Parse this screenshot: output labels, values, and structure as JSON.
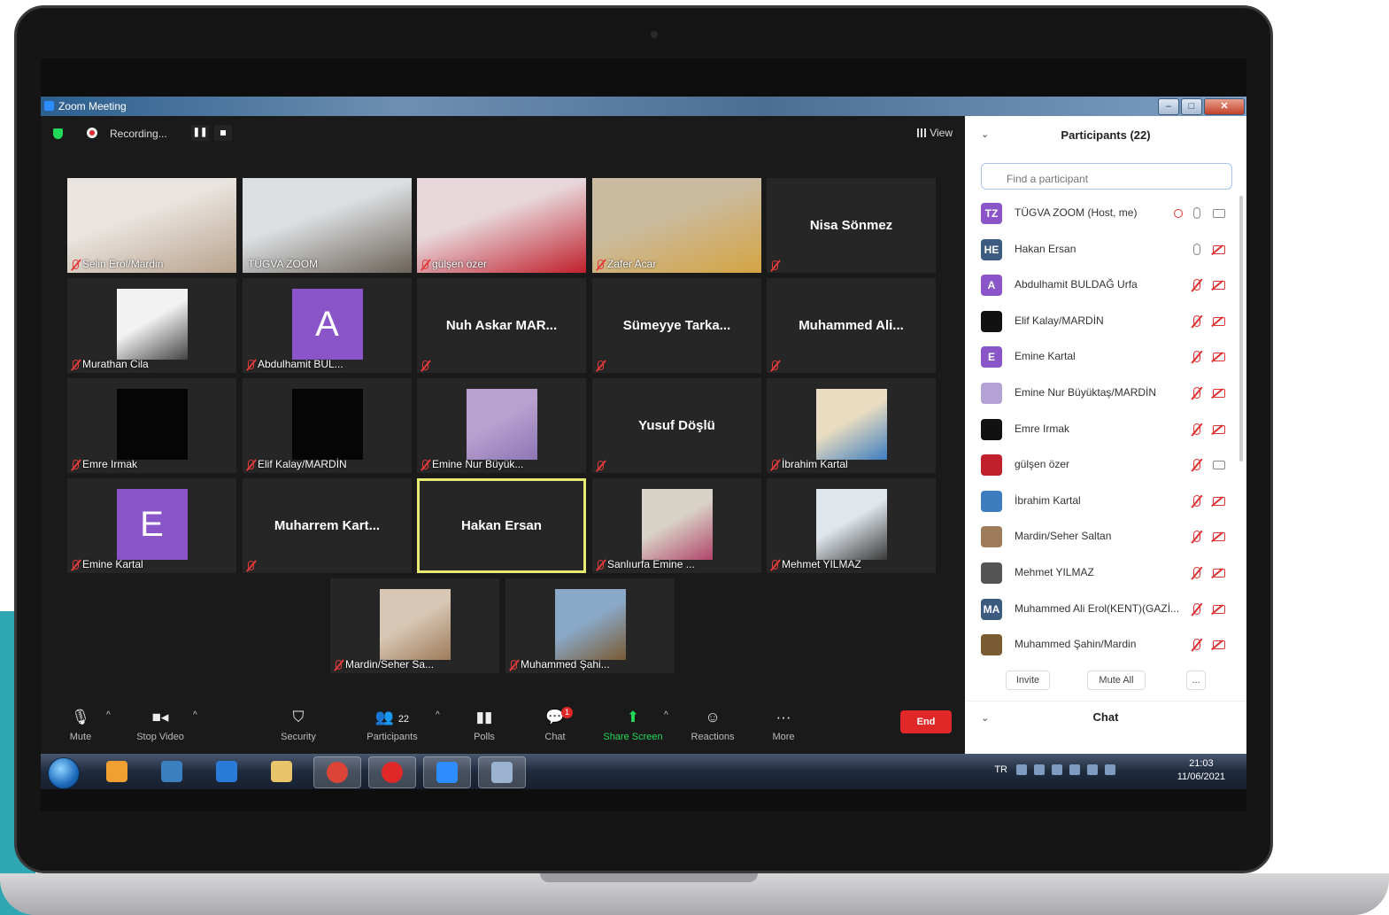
{
  "window": {
    "title": "Zoom Meeting"
  },
  "topbar": {
    "recording_label": "Recording...",
    "pause": "❚❚",
    "view_label": "View"
  },
  "tiles": [
    {
      "name": "Selin Erol/Mardin",
      "video": true,
      "muted": true,
      "colors": [
        "#e9e4df",
        "#b9a38d"
      ]
    },
    {
      "name": "TÜGVA ZOOM",
      "video": true,
      "muted": false,
      "colors": [
        "#dcdfe2",
        "#6b6258"
      ]
    },
    {
      "name": "gülşen özer",
      "video": true,
      "muted": true,
      "colors": [
        "#e7d6da",
        "#c0202c"
      ]
    },
    {
      "name": "Zafer Acar",
      "video": true,
      "muted": true,
      "colors": [
        "#cabba0",
        "#d5a442"
      ]
    },
    {
      "name": "",
      "big": "Nisa Sönmez",
      "muted": true
    },
    {
      "name": "Murathan Cila",
      "thumb": "photo",
      "muted": true,
      "colors": [
        "#f2f2f2",
        "#444444"
      ]
    },
    {
      "name": "Abdulhamit BUL...",
      "thumb": "letter",
      "letter": "A",
      "avatar_color": "#8a55c9",
      "muted": true
    },
    {
      "name": "",
      "big": "Nuh Askar MAR...",
      "muted": true
    },
    {
      "name": "",
      "big": "Sümeyye Tarka...",
      "muted": true
    },
    {
      "name": "",
      "big": "Muhammed Ali...",
      "muted": true
    },
    {
      "name": "Emre Irmak",
      "thumb": "black",
      "muted": true
    },
    {
      "name": "Elif Kalay/MARDİN",
      "thumb": "black",
      "muted": true
    },
    {
      "name": "Emine Nur Büyük...",
      "thumb": "photo",
      "muted": true,
      "colors": [
        "#b8a0cf",
        "#8d76b5"
      ]
    },
    {
      "name": "",
      "big": "Yusuf Döşlü",
      "muted": true
    },
    {
      "name": "İbrahim Kartal",
      "thumb": "photo",
      "muted": true,
      "colors": [
        "#e9dcc0",
        "#3d7dbf"
      ]
    },
    {
      "name": "Emine Kartal",
      "thumb": "letter",
      "letter": "E",
      "avatar_color": "#8a55c9",
      "muted": true
    },
    {
      "name": "",
      "big": "Muharrem Kart...",
      "muted": true
    },
    {
      "name": "",
      "big": "Hakan Ersan",
      "muted": false,
      "active": true
    },
    {
      "name": "Sanlıurfa Emine ...",
      "thumb": "photo",
      "muted": true,
      "colors": [
        "#d9d2c7",
        "#b0456a"
      ]
    },
    {
      "name": "Mehmet YILMAZ",
      "thumb": "photo",
      "muted": true,
      "colors": [
        "#dfe6ec",
        "#3a3a3a"
      ]
    },
    {
      "name": "Mardin/Seher Sa...",
      "thumb": "photo",
      "muted": true,
      "colors": [
        "#d8c6b4",
        "#9d7b5a"
      ]
    },
    {
      "name": "Muhammed Şahi...",
      "thumb": "photo",
      "muted": true,
      "colors": [
        "#8aa9c9",
        "#7a5a32"
      ]
    }
  ],
  "toolbar": {
    "mute": "Mute",
    "stop_video": "Stop Video",
    "security": "Security",
    "participants": "Participants",
    "participants_count": "22",
    "polls": "Polls",
    "chat": "Chat",
    "chat_badge": "1",
    "share_screen": "Share Screen",
    "reactions": "Reactions",
    "more": "More",
    "end": "End"
  },
  "panel": {
    "title": "Participants (22)",
    "search_placeholder": "Find a participant",
    "participants": [
      {
        "initials": "TZ",
        "name": "TÜGVA ZOOM (Host, me)",
        "color": "#8a55c9",
        "mic": "on",
        "cam": "on",
        "rec": true
      },
      {
        "initials": "HE",
        "name": "Hakan Ersan",
        "color": "#3d5a80",
        "mic": "on",
        "cam": "off"
      },
      {
        "initials": "A",
        "name": "Abdulhamit BULDAĞ Urfa",
        "color": "#8a55c9",
        "mic": "off",
        "cam": "off"
      },
      {
        "initials": "",
        "name": "Elif Kalay/MARDİN",
        "color": "#111111",
        "mic": "off",
        "cam": "off"
      },
      {
        "initials": "E",
        "name": "Emine Kartal",
        "color": "#8a55c9",
        "mic": "off",
        "cam": "off"
      },
      {
        "initials": "",
        "name": "Emine Nur Büyüktaş/MARDİN",
        "color": "#b5a2d4",
        "mic": "off",
        "cam": "off"
      },
      {
        "initials": "",
        "name": "Emre Irmak",
        "color": "#111111",
        "mic": "off",
        "cam": "off"
      },
      {
        "initials": "",
        "name": "gülşen özer",
        "color": "#c0202c",
        "mic": "off",
        "cam": "on"
      },
      {
        "initials": "",
        "name": "İbrahim Kartal",
        "color": "#3d7dbf",
        "mic": "off",
        "cam": "off"
      },
      {
        "initials": "",
        "name": "Mardin/Seher Saltan",
        "color": "#9d7b5a",
        "mic": "off",
        "cam": "off"
      },
      {
        "initials": "",
        "name": "Mehmet YILMAZ",
        "color": "#555555",
        "mic": "off",
        "cam": "off"
      },
      {
        "initials": "MA",
        "name": "Muhammed Ali Erol(KENT)(GAZİ...",
        "color": "#3d5a80",
        "mic": "off",
        "cam": "off"
      },
      {
        "initials": "",
        "name": "Muhammed Şahin/Mardin",
        "color": "#7a5a32",
        "mic": "off",
        "cam": "off"
      }
    ],
    "invite": "Invite",
    "mute_all": "Mute All",
    "more": "...",
    "chat_title": "Chat"
  },
  "taskbar": {
    "lang": "TR",
    "time": "21:03",
    "date": "11/06/2021",
    "apps": [
      "media-player-icon",
      "explorer-window-icon",
      "internet-explorer-icon",
      "file-explorer-icon",
      "chrome-icon",
      "opera-icon",
      "zoom-app-icon",
      "calculator-icon"
    ]
  }
}
